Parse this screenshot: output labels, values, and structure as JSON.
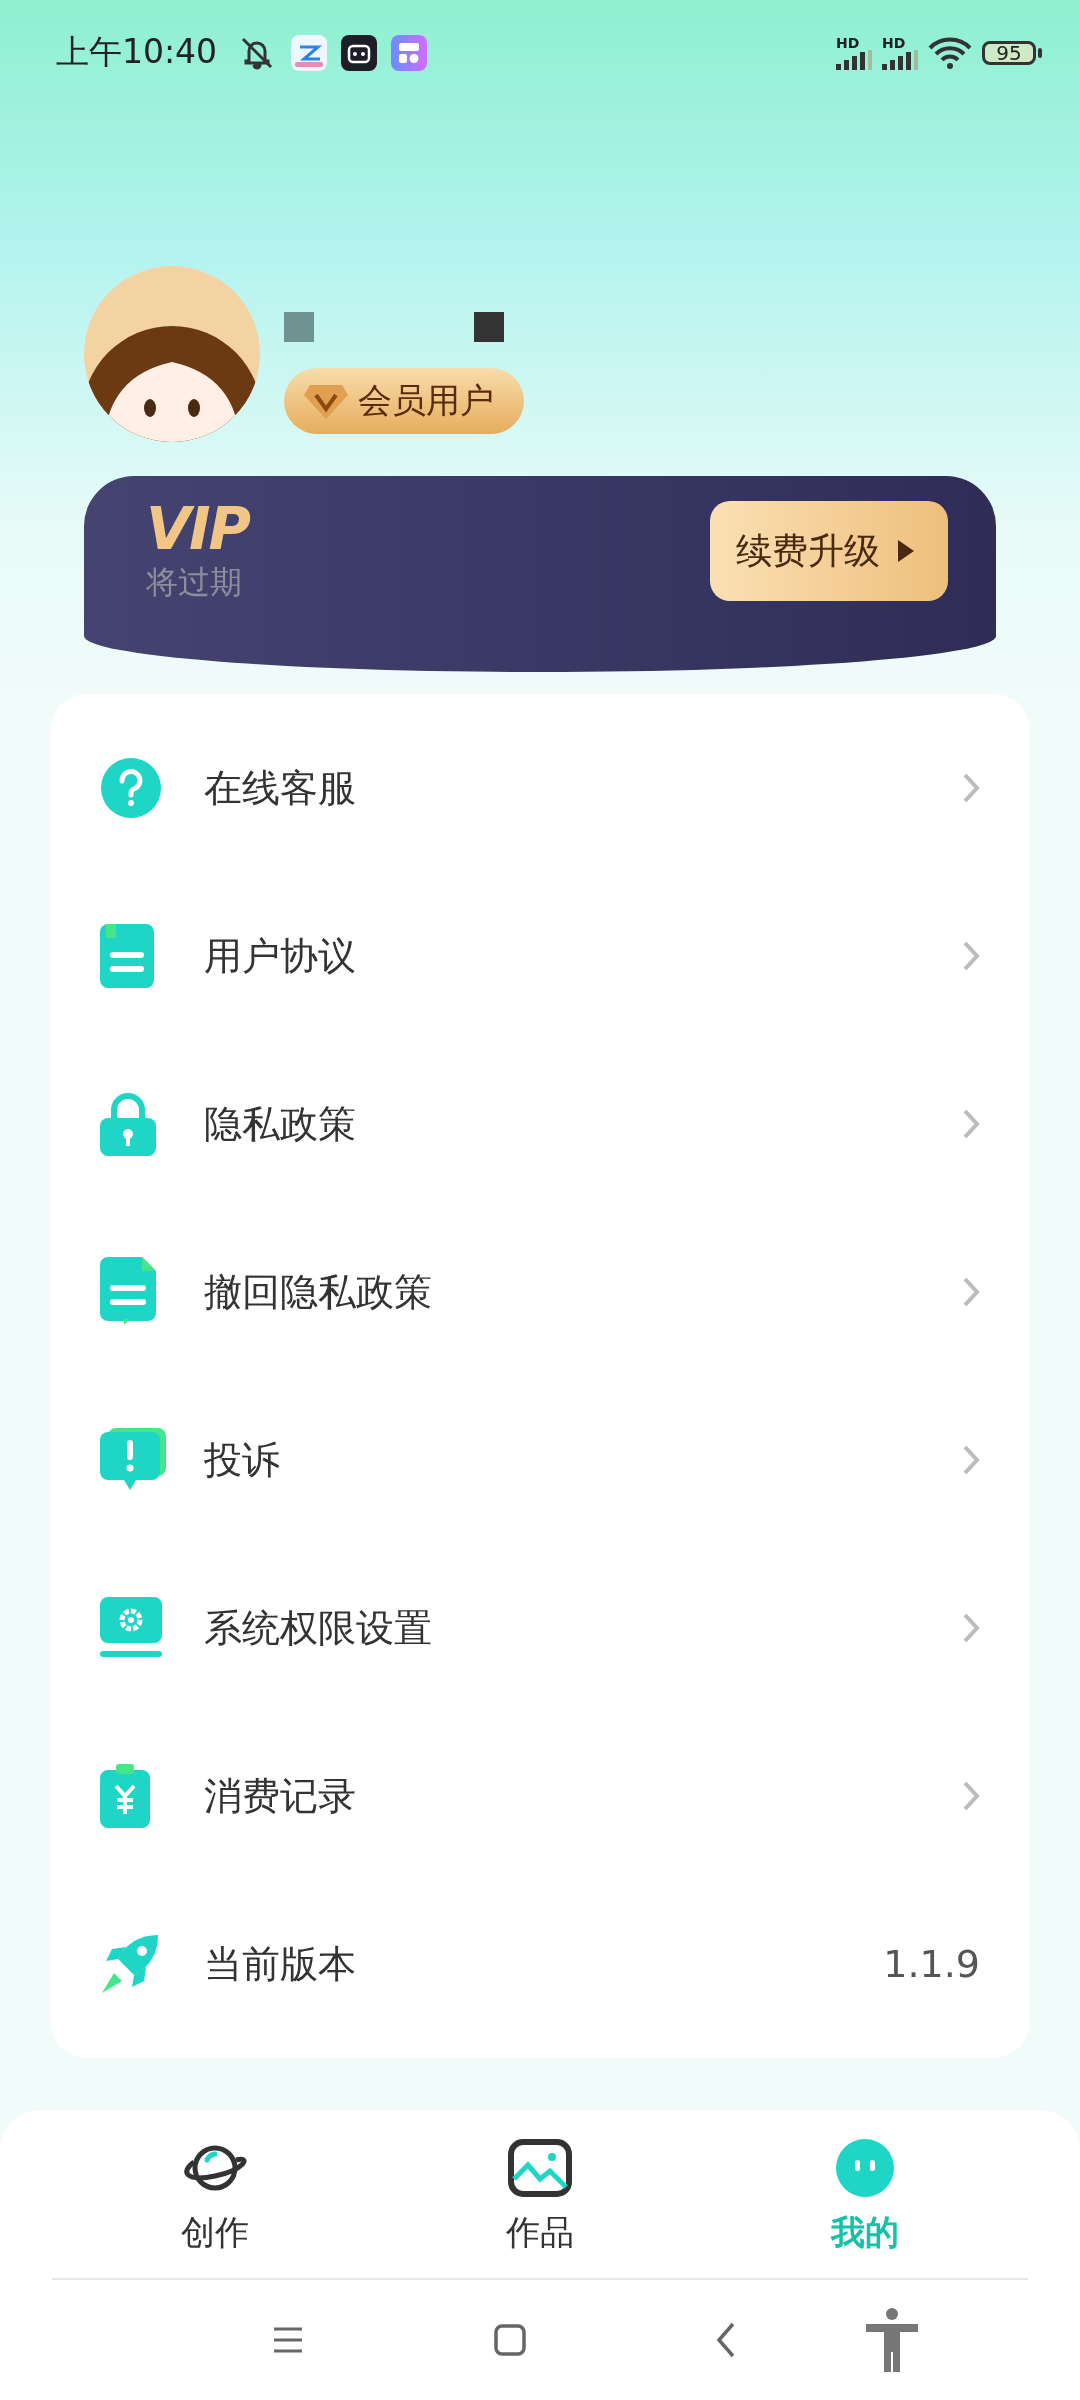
{
  "status_bar": {
    "time": "上午10:40",
    "signal_labels": [
      "HD",
      "HD"
    ],
    "battery": "95"
  },
  "profile": {
    "badge": "会员用户"
  },
  "vip_card": {
    "logo": "VIP",
    "status": "将过期",
    "button": "续费升级"
  },
  "menu": [
    {
      "kind": "help",
      "label": "在线客服"
    },
    {
      "kind": "document",
      "label": "用户协议"
    },
    {
      "kind": "lock",
      "label": "隐私政策"
    },
    {
      "kind": "revoke",
      "label": "撤回隐私政策"
    },
    {
      "kind": "complaint",
      "label": "投诉"
    },
    {
      "kind": "settings",
      "label": "系统权限设置"
    },
    {
      "kind": "receipt",
      "label": "消费记录"
    },
    {
      "kind": "version",
      "label": "当前版本",
      "value": "1.1.9"
    }
  ],
  "tabs": [
    {
      "kind": "create",
      "label": "创作",
      "selected": false
    },
    {
      "kind": "works",
      "label": "作品",
      "selected": false
    },
    {
      "kind": "mine",
      "label": "我的",
      "selected": true
    }
  ]
}
